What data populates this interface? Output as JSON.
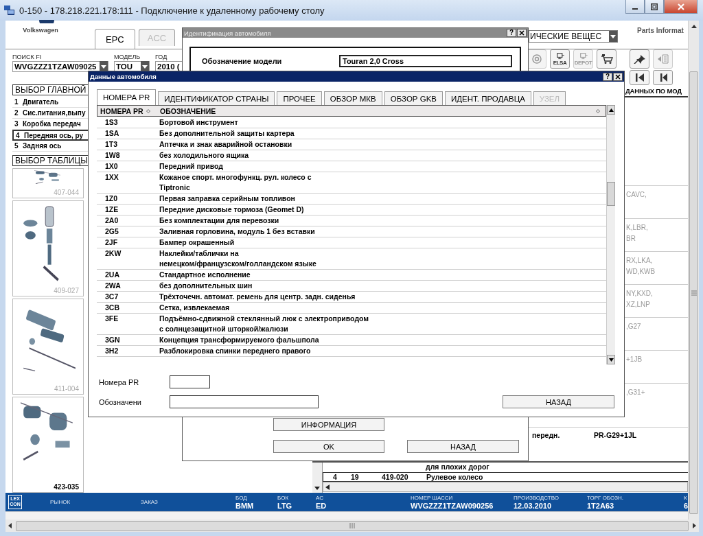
{
  "window": {
    "title": "0-150 - 178.218.221.178:111 - Подключение к удаленному рабочему столу"
  },
  "app": {
    "brand": "Volkswagen",
    "tabs": [
      {
        "label": "EPC",
        "selected": true,
        "disabled": false
      },
      {
        "label": "ACC",
        "selected": false,
        "disabled": true
      }
    ],
    "category_dropdown": {
      "value": "ИЧЕСКИЕ ВЕЩЕС"
    },
    "product_name": "Parts Informat",
    "search": [
      {
        "label": "ПОИСК FI",
        "value": "WVGZZZ1TZAW09025",
        "dropdown": true
      },
      {
        "label": "МОДЕЛЬ",
        "value": "TOU",
        "dropdown": true
      },
      {
        "label": "ГОД",
        "value": "2010 ("
      }
    ],
    "toolbar": [
      [
        {
          "kind": "at",
          "disabled": true
        },
        {
          "kind": "monitor",
          "label": "ELSA",
          "disabled": false
        },
        {
          "kind": "monitor",
          "label": "DEPOT",
          "disabled": true
        },
        {
          "kind": "cart",
          "disabled": false
        },
        {
          "kind": "pin",
          "disabled": false
        },
        {
          "kind": "document",
          "disabled": true
        }
      ],
      [
        {
          "kind": "first",
          "disabled": false
        },
        {
          "kind": "previous",
          "disabled": false
        }
      ]
    ],
    "main_groups": {
      "title": "ВЫБОР ГЛАВНОЙ",
      "items": [
        {
          "number": "1",
          "label": "Двигатель",
          "selected": false
        },
        {
          "number": "2",
          "label": "Сис.питания,выпу",
          "selected": false
        },
        {
          "number": "3",
          "label": "Коробка передач",
          "selected": false
        },
        {
          "number": "4",
          "label": "Передняя ось, ру",
          "selected": true
        },
        {
          "number": "5",
          "label": "Задняя ось",
          "selected": false
        }
      ]
    },
    "table_selection": {
      "title": "ВЫБОР ТАБЛИЦЫ",
      "thumbnails": [
        {
          "number": "407-044",
          "selected": false
        },
        {
          "number": "409-027",
          "selected": false
        },
        {
          "number": "411-004",
          "selected": false
        },
        {
          "number": "423-035",
          "selected": true
        }
      ]
    },
    "parts_list": {
      "header": "ДАННЫХ ПО МОД",
      "rows": [
        {
          "lines": [
            "CAVC,"
          ]
        },
        {
          "lines": [
            "K,LBR,",
            "BR"
          ]
        },
        {
          "lines": [
            "RX,LKA,",
            "WD,KWB"
          ]
        },
        {
          "lines": [
            "NY,KXD,",
            "XZ,LNP"
          ]
        },
        {
          "lines": [
            ",G27"
          ]
        },
        {
          "lines": [
            "+1JB"
          ]
        },
        {
          "lines": [
            ",G31+"
          ]
        }
      ],
      "remark_row": {
        "remark": "передн.",
        "codes": "PR-G29+1JL"
      },
      "sub_list": {
        "note": "для плохих дорог",
        "rows": [
          {
            "cells": [
              "4",
              "19",
              "419-020",
              "Рулевое колесо"
            ]
          }
        ]
      }
    }
  },
  "status_bar": {
    "logo": "LEX\nCON",
    "fields": [
      {
        "label": "РЫНОК"
      },
      {
        "label": "ЗАКАЗ"
      },
      {
        "label": "БОД",
        "value": "BMM"
      },
      {
        "label": "БОК",
        "value": "LTG"
      },
      {
        "label": "АС",
        "value": "ED"
      },
      {
        "label": "НОМЕР ШАССИ",
        "value": "WVGZZZ1TZAW090256"
      },
      {
        "label": "ПРОИЗВОДСТВО",
        "value": "12.03.2010"
      },
      {
        "label": "ТОРГ ОБОЗН.",
        "value": "1T2A63"
      },
      {
        "label": "К",
        "value": "6"
      }
    ]
  },
  "identification_dialog": {
    "title": "Идентификация автомобиля",
    "help_button": "?",
    "model_label": "Обозначение модели",
    "model_value": "Touran 2,0 Cross",
    "buttons": [
      {
        "kind": "info",
        "label": "ИНФОРМАЦИЯ"
      },
      {
        "kind": "ok",
        "label": "OK"
      },
      {
        "kind": "back",
        "label": "НАЗАД"
      }
    ]
  },
  "vehicle_data_dialog": {
    "title": "Данные автомобиля",
    "help_button": "?",
    "tabs": [
      {
        "label": "НОМЕРА PR",
        "selected": true,
        "disabled": false
      },
      {
        "label": "ИДЕНТИФИКАТОР СТРАНЫ",
        "selected": false,
        "disabled": false
      },
      {
        "label": "ПРОЧЕЕ",
        "selected": false,
        "disabled": false
      },
      {
        "label": "ОБЗОР МКВ",
        "selected": false,
        "disabled": false
      },
      {
        "label": "ОБЗОР GKB",
        "selected": false,
        "disabled": false
      },
      {
        "label": "ИДЕНТ. ПРОДАВЦА",
        "selected": false,
        "disabled": false
      },
      {
        "label": "УЗЕЛ",
        "selected": false,
        "disabled": true
      }
    ],
    "columns": [
      "НОМЕРА PR",
      "ОБОЗНАЧЕНИЕ"
    ],
    "rows": [
      {
        "code": "1S3",
        "description": "Бортовой инструмент"
      },
      {
        "code": "1SA",
        "description": "Без дополнительной защиты картера"
      },
      {
        "code": "1T3",
        "description": "Аптечка и знак аварийной остановки"
      },
      {
        "code": "1W8",
        "description": "без холодильного ящика"
      },
      {
        "code": "1X0",
        "description": "Передний привод"
      },
      {
        "code": "1XX",
        "description": "Кожаное спорт. многофункц. рул. колесо с\nTiptronic"
      },
      {
        "code": "1Z0",
        "description": "Первая заправка серийным топливон"
      },
      {
        "code": "1ZE",
        "description": "Передние дисковые тормоза (Geomet D)"
      },
      {
        "code": "2A0",
        "description": "Без комплектации для перевозки"
      },
      {
        "code": "2G5",
        "description": "Заливная горловина, модуль 1 без вставки"
      },
      {
        "code": "2JF",
        "description": "Бампер окрашенный"
      },
      {
        "code": "2KW",
        "description": "Наклейки/таблички на\nнемецком/французском/голландском языке"
      },
      {
        "code": "2UA",
        "description": "Стандартное исполнение"
      },
      {
        "code": "2WA",
        "description": "без дополнительных шин"
      },
      {
        "code": "3C7",
        "description": "Трёхточечн. автомат. ремень для центр. задн. сиденья"
      },
      {
        "code": "3CB",
        "description": "Сетка, извлекаемая"
      },
      {
        "code": "3FE",
        "description": "Подъёмно-сдвижной стеклянный люк с электроприводом\nс солнцезащитной шторкой/жалюзи"
      },
      {
        "code": "3GN",
        "description": "Концепция трансформируемого фальшпола"
      },
      {
        "code": "3H2",
        "description": "Разблокировка спинки переднего правого"
      }
    ],
    "pr_label": "Номера PR",
    "designation_label": "Обозначени",
    "back_button": "НАЗАД"
  }
}
